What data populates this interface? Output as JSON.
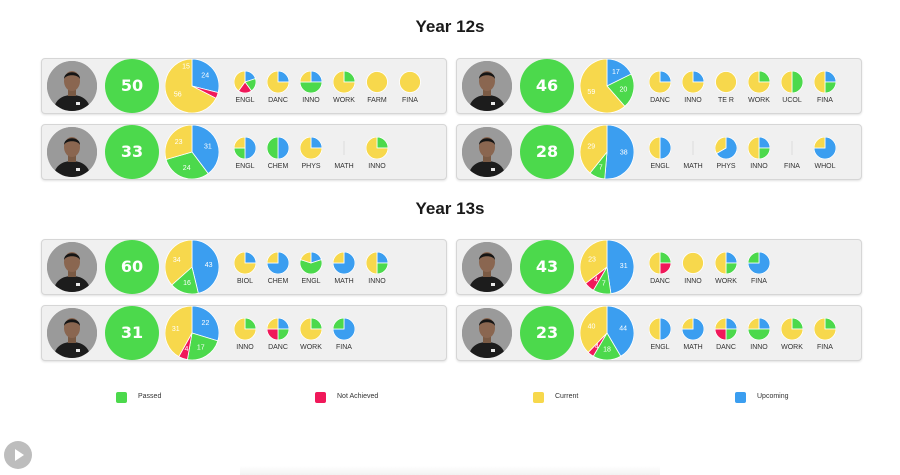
{
  "colors": {
    "passed": "#4cd94c",
    "not_achieved": "#f0185a",
    "current": "#f7d84c",
    "upcoming": "#3b9ef0"
  },
  "sections": [
    {
      "title": "Year 12s",
      "students": [
        {
          "credits": "50",
          "big_pie": {
            "passed": 0,
            "not_achieved": 3,
            "current": 56,
            "upcoming": 24,
            "passed_label": "",
            "not_achieved_label": "",
            "current_label": "56",
            "upcoming_label": "24",
            "extra_passed_label": "15"
          },
          "subjects": [
            {
              "name": "ENGL",
              "passed": 1,
              "not_achieved": 1,
              "current": 2,
              "upcoming": 1
            },
            {
              "name": "DANC",
              "passed": 0,
              "not_achieved": 0,
              "current": 3,
              "upcoming": 1
            },
            {
              "name": "INNO",
              "passed": 2,
              "not_achieved": 0,
              "current": 1,
              "upcoming": 1
            },
            {
              "name": "WORK",
              "passed": 1,
              "not_achieved": 0,
              "current": 3,
              "upcoming": 0
            },
            {
              "name": "FARM",
              "passed": 0,
              "not_achieved": 0,
              "current": 1,
              "upcoming": 0
            },
            {
              "name": "FINA",
              "passed": 0,
              "not_achieved": 0,
              "current": 1,
              "upcoming": 0
            }
          ]
        },
        {
          "credits": "46",
          "big_pie": {
            "passed": 20,
            "not_achieved": 0,
            "current": 59,
            "upcoming": 17,
            "passed_label": "20",
            "not_achieved_label": "",
            "current_label": "59",
            "upcoming_label": "17"
          },
          "subjects": [
            {
              "name": "DANC",
              "passed": 0,
              "not_achieved": 0,
              "current": 3,
              "upcoming": 1
            },
            {
              "name": "INNO",
              "passed": 0,
              "not_achieved": 0,
              "current": 3,
              "upcoming": 1
            },
            {
              "name": "TE R",
              "passed": 0,
              "not_achieved": 0,
              "current": 1,
              "upcoming": 0
            },
            {
              "name": "WORK",
              "passed": 1,
              "not_achieved": 0,
              "current": 3,
              "upcoming": 0
            },
            {
              "name": "UCOL",
              "passed": 1,
              "not_achieved": 0,
              "current": 1,
              "upcoming": 0
            },
            {
              "name": "FINA",
              "passed": 1,
              "not_achieved": 0,
              "current": 2,
              "upcoming": 1
            }
          ]
        },
        {
          "credits": "33",
          "big_pie": {
            "passed": 24,
            "not_achieved": 0,
            "current": 23,
            "upcoming": 31,
            "passed_label": "24",
            "not_achieved_label": "",
            "current_label": "23",
            "upcoming_label": "31"
          },
          "subjects": [
            {
              "name": "ENGL",
              "passed": 1,
              "not_achieved": 0,
              "current": 1,
              "upcoming": 2
            },
            {
              "name": "CHEM",
              "passed": 2,
              "not_achieved": 0,
              "current": 0,
              "upcoming": 2
            },
            {
              "name": "PHYS",
              "passed": 0,
              "not_achieved": 0,
              "current": 3,
              "upcoming": 1
            },
            {
              "name": "MATH",
              "passed": 0,
              "not_achieved": 0,
              "current": 0,
              "upcoming": 0
            },
            {
              "name": "INNO",
              "passed": 1,
              "not_achieved": 0,
              "current": 3,
              "upcoming": 0
            }
          ]
        },
        {
          "credits": "28",
          "big_pie": {
            "passed": 7,
            "not_achieved": 0,
            "current": 29,
            "upcoming": 38,
            "passed_label": "7",
            "not_achieved_label": "",
            "current_label": "29",
            "upcoming_label": "38"
          },
          "subjects": [
            {
              "name": "ENGL",
              "passed": 0,
              "not_achieved": 0,
              "current": 1,
              "upcoming": 1
            },
            {
              "name": "MATH",
              "passed": 0,
              "not_achieved": 0,
              "current": 0,
              "upcoming": 0
            },
            {
              "name": "PHYS",
              "passed": 0,
              "not_achieved": 0,
              "current": 1,
              "upcoming": 2
            },
            {
              "name": "INNO",
              "passed": 1,
              "not_achieved": 0,
              "current": 2,
              "upcoming": 1
            },
            {
              "name": "FINA",
              "passed": 0,
              "not_achieved": 0,
              "current": 0,
              "upcoming": 0
            },
            {
              "name": "WHOL",
              "passed": 0,
              "not_achieved": 0,
              "current": 1,
              "upcoming": 3
            }
          ]
        }
      ]
    },
    {
      "title": "Year 13s",
      "students": [
        {
          "credits": "60",
          "big_pie": {
            "passed": 16,
            "not_achieved": 0,
            "current": 34,
            "upcoming": 43,
            "passed_label": "16",
            "not_achieved_label": "",
            "current_label": "34",
            "upcoming_label": "43"
          },
          "subjects": [
            {
              "name": "BIOL",
              "passed": 0,
              "not_achieved": 0,
              "current": 3,
              "upcoming": 1
            },
            {
              "name": "CHEM",
              "passed": 0,
              "not_achieved": 0,
              "current": 1,
              "upcoming": 3
            },
            {
              "name": "ENGL",
              "passed": 3,
              "not_achieved": 0,
              "current": 1,
              "upcoming": 1
            },
            {
              "name": "MATH",
              "passed": 0,
              "not_achieved": 0,
              "current": 1,
              "upcoming": 3
            },
            {
              "name": "INNO",
              "passed": 1,
              "not_achieved": 0,
              "current": 2,
              "upcoming": 1
            }
          ]
        },
        {
          "credits": "43",
          "big_pie": {
            "passed": 7,
            "not_achieved": 4,
            "current": 23,
            "upcoming": 31,
            "passed_label": "7",
            "not_achieved_label": "4",
            "current_label": "23",
            "upcoming_label": "31"
          },
          "subjects": [
            {
              "name": "DANC",
              "passed": 1,
              "not_achieved": 1,
              "current": 2,
              "upcoming": 0
            },
            {
              "name": "INNO",
              "passed": 0,
              "not_achieved": 0,
              "current": 1,
              "upcoming": 0
            },
            {
              "name": "WORK",
              "passed": 1,
              "not_achieved": 0,
              "current": 2,
              "upcoming": 1
            },
            {
              "name": "FINA",
              "passed": 1,
              "not_achieved": 0,
              "current": 0,
              "upcoming": 3
            }
          ]
        },
        {
          "credits": "31",
          "big_pie": {
            "passed": 17,
            "not_achieved": 4,
            "current": 31,
            "upcoming": 22,
            "passed_label": "17",
            "not_achieved_label": "4",
            "current_label": "31",
            "upcoming_label": "22"
          },
          "subjects": [
            {
              "name": "INNO",
              "passed": 1,
              "not_achieved": 0,
              "current": 3,
              "upcoming": 0
            },
            {
              "name": "DANC",
              "passed": 1,
              "not_achieved": 1,
              "current": 1,
              "upcoming": 1
            },
            {
              "name": "WORK",
              "passed": 1,
              "not_achieved": 0,
              "current": 3,
              "upcoming": 0
            },
            {
              "name": "FINA",
              "passed": 1,
              "not_achieved": 0,
              "current": 0,
              "upcoming": 3
            }
          ]
        },
        {
          "credits": "23",
          "big_pie": {
            "passed": 18,
            "not_achieved": 4,
            "current": 40,
            "upcoming": 44,
            "passed_label": "18",
            "not_achieved_label": "4",
            "current_label": "40",
            "upcoming_label": "44"
          },
          "subjects": [
            {
              "name": "ENGL",
              "passed": 0,
              "not_achieved": 0,
              "current": 1,
              "upcoming": 1
            },
            {
              "name": "MATH",
              "passed": 0,
              "not_achieved": 0,
              "current": 1,
              "upcoming": 3
            },
            {
              "name": "DANC",
              "passed": 1,
              "not_achieved": 1,
              "current": 1,
              "upcoming": 1
            },
            {
              "name": "INNO",
              "passed": 2,
              "not_achieved": 0,
              "current": 1,
              "upcoming": 1
            },
            {
              "name": "WORK",
              "passed": 1,
              "not_achieved": 0,
              "current": 3,
              "upcoming": 0
            },
            {
              "name": "FINA",
              "passed": 1,
              "not_achieved": 0,
              "current": 3,
              "upcoming": 0
            }
          ]
        }
      ]
    }
  ],
  "legend": [
    {
      "key": "passed",
      "label": "Passed"
    },
    {
      "key": "not_achieved",
      "label": "Not Achieved"
    },
    {
      "key": "current",
      "label": "Current"
    },
    {
      "key": "upcoming",
      "label": "Upcoming"
    }
  ],
  "controls": {
    "play_icon": "play-icon"
  }
}
